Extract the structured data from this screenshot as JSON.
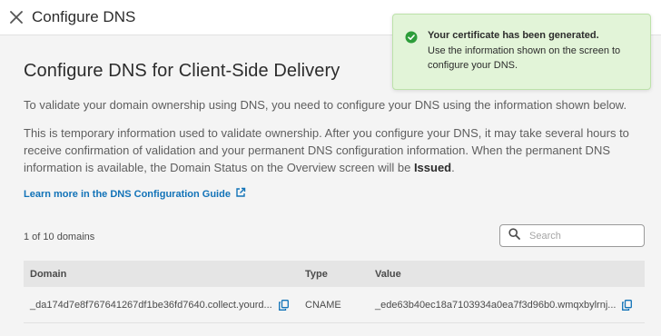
{
  "header": {
    "title": "Configure DNS",
    "close_icon": "close-icon"
  },
  "main": {
    "title": "Configure DNS for Client-Side Delivery",
    "intro": "To validate your domain ownership using DNS, you need to configure your DNS using the information shown below.",
    "info_text": "This is temporary information used to validate ownership. After you configure your DNS, it may take several hours to receive confirmation of validation and your permanent DNS configuration information. When the permanent DNS information is available, the Domain Status on the Overview screen will be ",
    "info_status": "Issued",
    "info_end": ".",
    "learn_more_label": "Learn more in the DNS Configuration Guide",
    "learn_more_icon": "external-link-icon"
  },
  "table": {
    "count_label": "1 of 10 domains",
    "search_placeholder": "Search",
    "columns": [
      "Domain",
      "Type",
      "Value"
    ],
    "rows": [
      {
        "domain": "_da174d7e8f767641267df1be36fd7640.collect.yourd...",
        "type": "CNAME",
        "value": "_ede63b40ec18a7103934a0ea7f3d96b0.wmqxbylrnj..."
      }
    ]
  },
  "toast": {
    "title": "Your certificate has been generated.",
    "message": "Use the information shown on the screen to configure your DNS.",
    "icon": "check-circle-icon",
    "color": "#2d9d3a"
  },
  "colors": {
    "link": "#1273b8",
    "toast_bg": "#e2f4d8"
  }
}
